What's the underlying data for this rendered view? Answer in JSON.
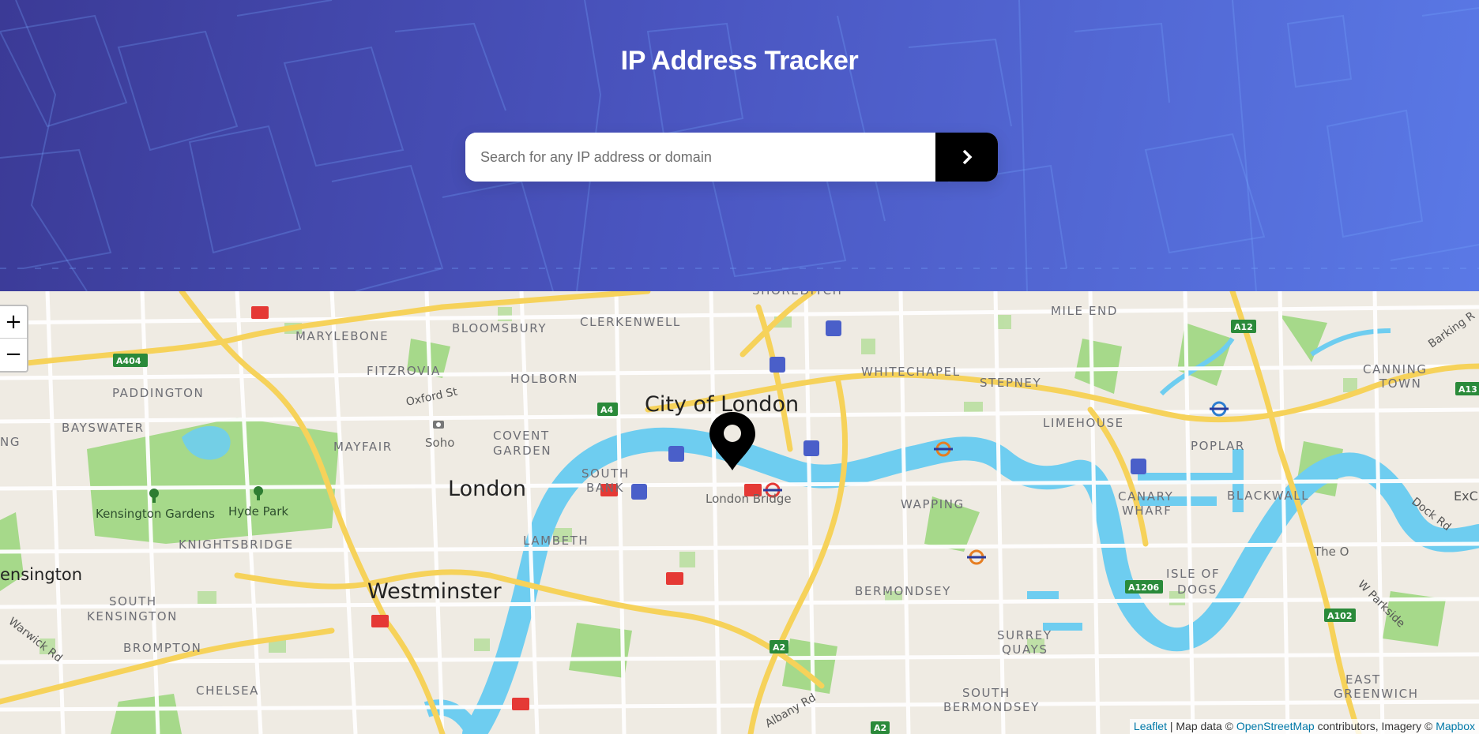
{
  "header": {
    "title": "IP Address Tracker",
    "search": {
      "placeholder": "Search for any IP address or domain",
      "value": ""
    },
    "submit_icon": "chevron-right-icon"
  },
  "map": {
    "zoom_in_label": "+",
    "zoom_out_label": "−",
    "marker_icon": "location-pin-icon",
    "labels": {
      "marylebone": "MARYLEBONE",
      "bloomsbury": "BLOOMSBURY",
      "clerkenwell": "CLERKENWELL",
      "mile_end": "MILE END",
      "fitzrovia": "FITZROVIA",
      "holborn": "HOLBORN",
      "whitechapel": "WHITECHAPEL",
      "stepney": "STEPNEY",
      "canning_town": "CANNING",
      "canning_town2": "TOWN",
      "paddington": "PADDINGTON",
      "bayswater": "BAYSWATER",
      "mayfair": "MAYFAIR",
      "covent_garden": "COVENT",
      "covent_garden2": "GARDEN",
      "limehouse": "LIMEHOUSE",
      "poplar": "POPLAR",
      "south_bank": "SOUTH",
      "south_bank2": "BANK",
      "wapping": "WAPPING",
      "canary_wharf": "CANARY",
      "canary_wharf2": "WHARF",
      "blackwall": "BLACKWALL",
      "lambeth": "LAMBETH",
      "knightsbridge": "KNIGHTSBRIDGE",
      "bermondsey": "BERMONDSEY",
      "isle_of_dogs": "ISLE OF",
      "isle_of_dogs2": "DOGS",
      "south_kensington": "SOUTH",
      "south_kensington2": "KENSINGTON",
      "brompton": "BROMPTON",
      "surrey_quays": "SURREY",
      "surrey_quays2": "QUAYS",
      "chelsea": "CHELSEA",
      "south_bermondsey": "SOUTH",
      "south_bermondsey2": "BERMONDSEY",
      "east_greenwich": "EAST",
      "east_greenwich2": "GREENWICH",
      "city_of_london": "City of London",
      "london": "London",
      "westminster": "Westminster",
      "kensington": "ensington",
      "london_bridge": "London Bridge",
      "kensington_gardens": "Kensington Gardens",
      "hyde_park": "Hyde Park",
      "soho": "Soho",
      "the_o2": "The O",
      "oxford_st": "Oxford St",
      "warwick_rd": "Warwick Rd",
      "albany_rd": "Albany Rd",
      "dock_rd": "Dock Rd",
      "w_parkside": "W Parkside",
      "barking_rd": "Barking R",
      "shoreditch": "SHOREDITCH",
      "ng": "NG",
      "exc": "ExC"
    },
    "road_shields": {
      "a404": "A404",
      "a4": "A4",
      "a12": "A12",
      "a13": "A13",
      "a1206": "A1206",
      "a102": "A102",
      "a2": "A2",
      "a2b": "A2"
    },
    "colors": {
      "water": "#6ecdf0",
      "park": "#a6d98a",
      "major_road": "#f6d25a",
      "land": "#efebe3",
      "header_gradient_start": "#3b3a96",
      "header_gradient_end": "#5a79e6"
    },
    "attribution": {
      "leaflet": "Leaflet",
      "sep1": " | Map data © ",
      "osm": "OpenStreetMap",
      "sep2": " contributors, Imagery © ",
      "mapbox": "Mapbox"
    }
  }
}
